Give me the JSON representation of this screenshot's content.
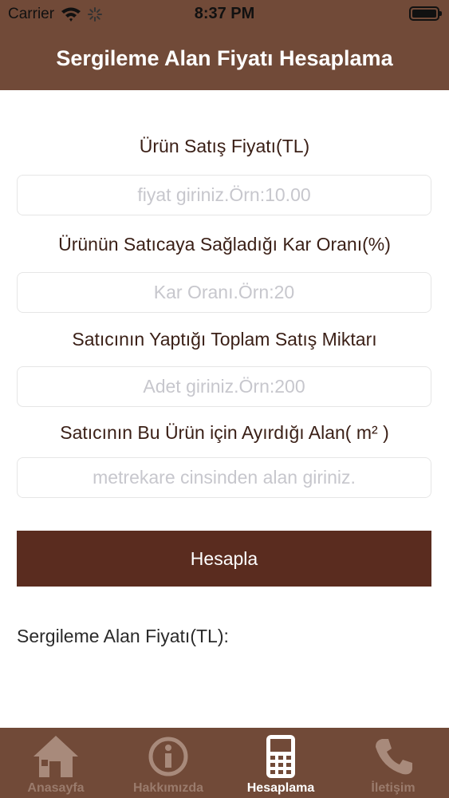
{
  "status_bar": {
    "carrier": "Carrier",
    "time": "8:37 PM"
  },
  "header": {
    "title": "Sergileme Alan Fiyatı Hesaplama"
  },
  "form": {
    "fields": [
      {
        "label": "Ürün Satış Fiyatı(TL)",
        "placeholder": "fiyat giriniz.Örn:10.00",
        "value": ""
      },
      {
        "label": "Ürünün Satıcaya Sağladığı Kar Oranı(%)",
        "placeholder": "Kar Oranı.Örn:20",
        "value": ""
      },
      {
        "label": "Satıcının Yaptığı Toplam Satış Miktarı",
        "placeholder": "Adet giriniz.Örn:200",
        "value": ""
      },
      {
        "label": "Satıcının Bu Ürün için Ayırdığı Alan( m² )",
        "placeholder": "metrekare cinsinden alan giriniz.",
        "value": ""
      }
    ],
    "calculate_label": "Hesapla",
    "result_label": "Sergileme Alan Fiyatı(TL):"
  },
  "tab_bar": {
    "tabs": [
      {
        "label": "Anasayfa",
        "icon": "home-icon",
        "active": false
      },
      {
        "label": "Hakkımızda",
        "icon": "info-icon",
        "active": false
      },
      {
        "label": "Hesaplama",
        "icon": "calculator-icon",
        "active": true
      },
      {
        "label": "İletişim",
        "icon": "phone-icon",
        "active": false
      }
    ]
  },
  "colors": {
    "brand_brown": "#714a38",
    "button_brown": "#5a2c1f",
    "inactive_tab": "#9a7b6c"
  }
}
